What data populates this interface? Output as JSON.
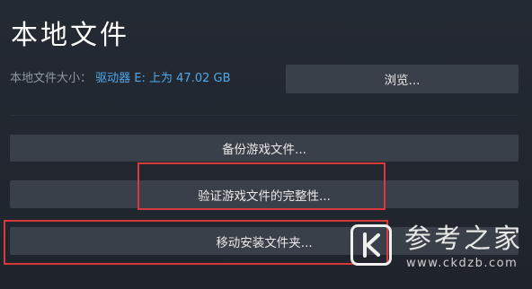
{
  "section": {
    "title": "本地文件"
  },
  "local_files": {
    "size_label": "本地文件大小：",
    "size_value": "驱动器 E: 上为 47.02 GB"
  },
  "buttons": {
    "browse": "浏览...",
    "backup": "备份游戏文件...",
    "verify": "验证游戏文件的完整性...",
    "move": "移动安装文件夹..."
  },
  "watermark": {
    "brand": "参考之家",
    "url": "www.ckdzb.com",
    "icon": "k-logo-icon"
  },
  "colors": {
    "background": "#1e232b",
    "button": "#3a4049",
    "link_blue": "#4ea9ec",
    "highlight_red": "#d9393a"
  }
}
